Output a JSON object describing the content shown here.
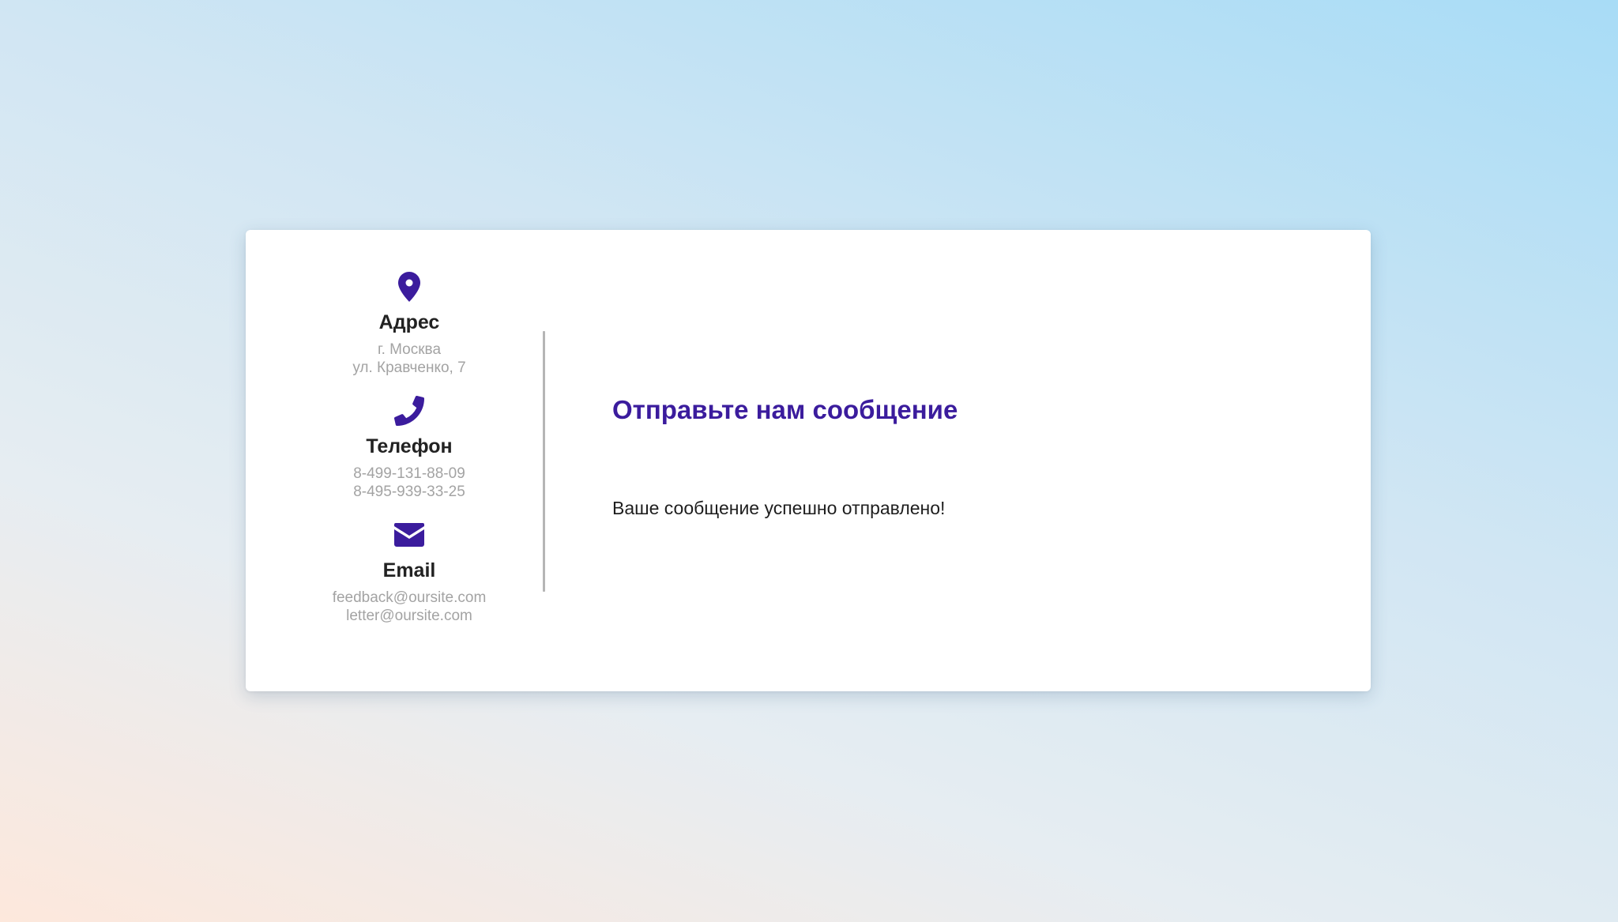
{
  "contacts": {
    "address": {
      "icon": "map-pin-icon",
      "title": "Адрес",
      "lines": [
        "г. Москва",
        "ул. Кравченко, 7"
      ]
    },
    "phone": {
      "icon": "phone-icon",
      "title": "Телефон",
      "lines": [
        "8-499-131-88-09",
        "8-495-939-33-25"
      ]
    },
    "email": {
      "icon": "envelope-icon",
      "title": "Email",
      "lines": [
        "feedback@oursite.com",
        "letter@oursite.com"
      ]
    }
  },
  "message": {
    "title": "Отправьте нам сообщение",
    "success_text": "Ваше сообщение успешно отправлено!"
  },
  "colors": {
    "accent": "#3b1c9d",
    "title_text": "#222222",
    "muted_text": "#a3a3a3",
    "card_background": "#ffffff"
  }
}
